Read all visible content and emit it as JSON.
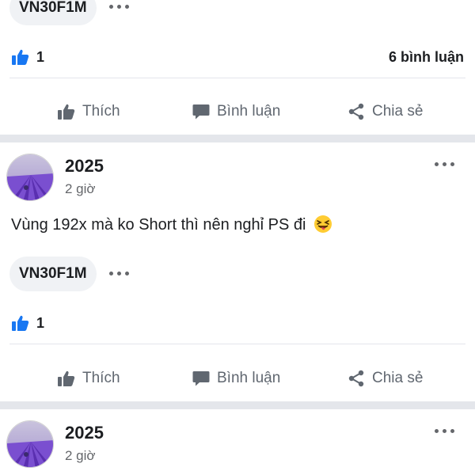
{
  "post1": {
    "tag": "VN30F1M",
    "like_count": "1",
    "comment_count": "6 bình luận"
  },
  "actions": {
    "like": "Thích",
    "comment": "Bình luận",
    "share": "Chia sẻ"
  },
  "post2": {
    "author": "2025",
    "time": "2 giờ",
    "text": "Vùng 192x mà ko Short thì nên nghỉ PS đi",
    "emoji": "😝",
    "tag": "VN30F1M",
    "like_count": "1"
  },
  "post3": {
    "author": "2025",
    "time": "2 giờ"
  },
  "colors": {
    "like_blue": "#1877f2",
    "separator": "#e4e6eb",
    "pill_bg": "#f0f2f5",
    "avatar_purple": "#7a4fd0"
  }
}
